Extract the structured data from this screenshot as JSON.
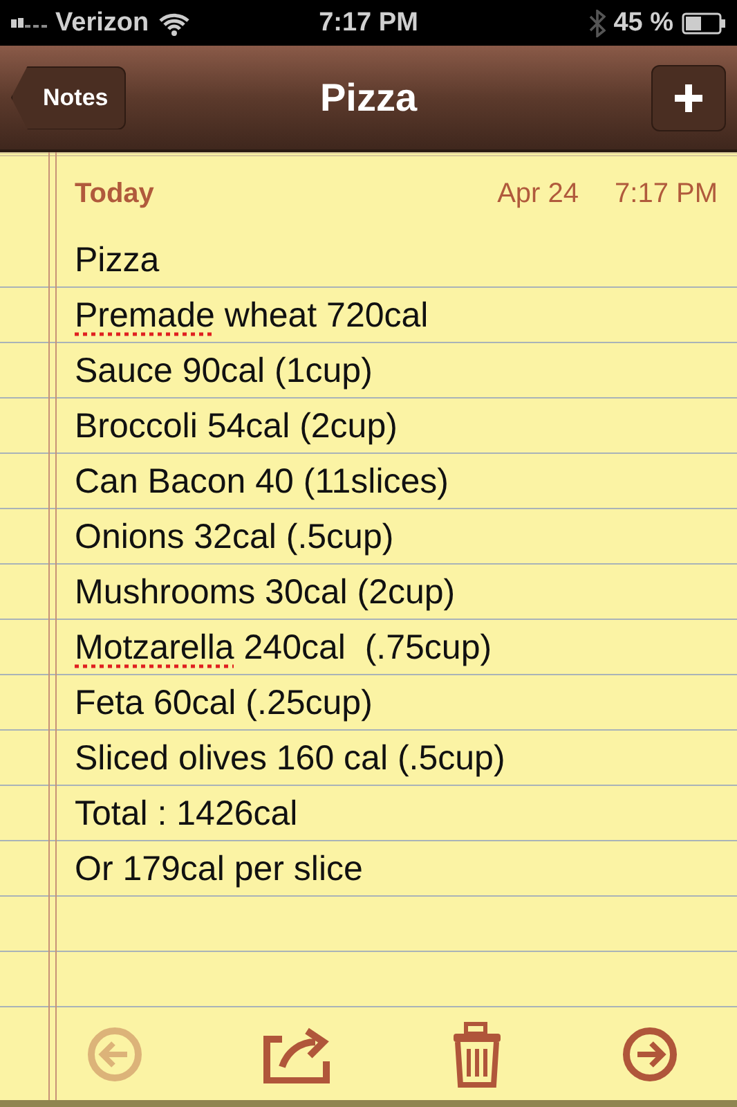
{
  "status_bar": {
    "carrier": "Verizon",
    "time": "7:17 PM",
    "battery": "45 %"
  },
  "nav_bar": {
    "back": "Notes",
    "title": "Pizza"
  },
  "note": {
    "day": "Today",
    "date": "Apr 24",
    "time": "7:17 PM",
    "lines": [
      [
        {
          "text": "Pizza",
          "misspelled": false
        }
      ],
      [
        {
          "text": "Premade",
          "misspelled": true
        },
        {
          "text": " wheat 720cal",
          "misspelled": false
        }
      ],
      [
        {
          "text": "Sauce 90cal (1cup)",
          "misspelled": false
        }
      ],
      [
        {
          "text": "Broccoli 54cal (2cup)",
          "misspelled": false
        }
      ],
      [
        {
          "text": "Can Bacon 40 (11slices)",
          "misspelled": false
        }
      ],
      [
        {
          "text": "Onions 32cal (.5cup)",
          "misspelled": false
        }
      ],
      [
        {
          "text": "Mushrooms 30cal (2cup)",
          "misspelled": false
        }
      ],
      [
        {
          "text": "Motzarella",
          "misspelled": true
        },
        {
          "text": " 240cal  (.75cup)",
          "misspelled": false
        }
      ],
      [
        {
          "text": "Feta 60cal (.25cup)",
          "misspelled": false
        }
      ],
      [
        {
          "text": "Sliced olives 160 cal (.5cup)",
          "misspelled": false
        }
      ],
      [
        {
          "text": "Total : 1426cal",
          "misspelled": false
        }
      ],
      [
        {
          "text": "Or 179cal per slice",
          "misspelled": false
        }
      ]
    ]
  },
  "toolbar": [
    {
      "kind": "previous",
      "disabled": true
    },
    {
      "kind": "share",
      "disabled": false
    },
    {
      "kind": "trash",
      "disabled": false
    },
    {
      "kind": "next",
      "disabled": false
    }
  ]
}
